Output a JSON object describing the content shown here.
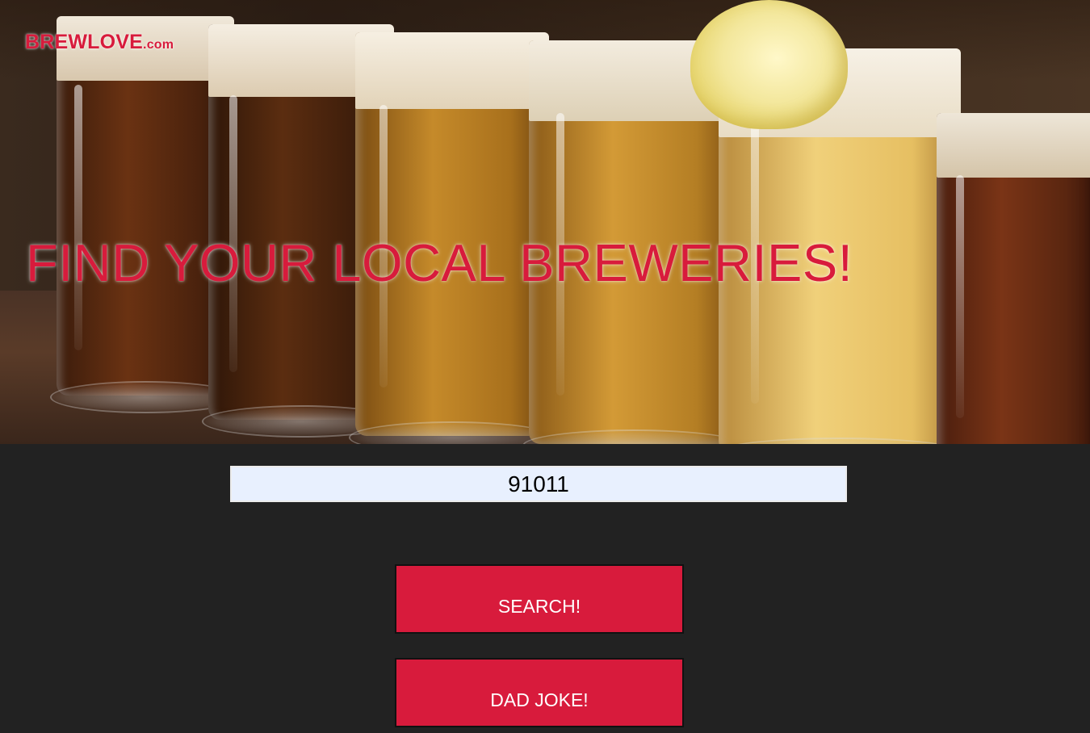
{
  "header": {
    "logo_main": "BREWLOVE",
    "logo_tld": ".com",
    "headline": "FIND YOUR LOCAL BREWERIES!"
  },
  "hero": {
    "image_icon": "beer-glasses-photo"
  },
  "search": {
    "value": "91011",
    "search_label": "SEARCH!",
    "joke_label": "DAD JOKE!"
  },
  "colors": {
    "accent": "#d81b3c",
    "background": "#222222",
    "input_background": "#e8f0fe"
  }
}
